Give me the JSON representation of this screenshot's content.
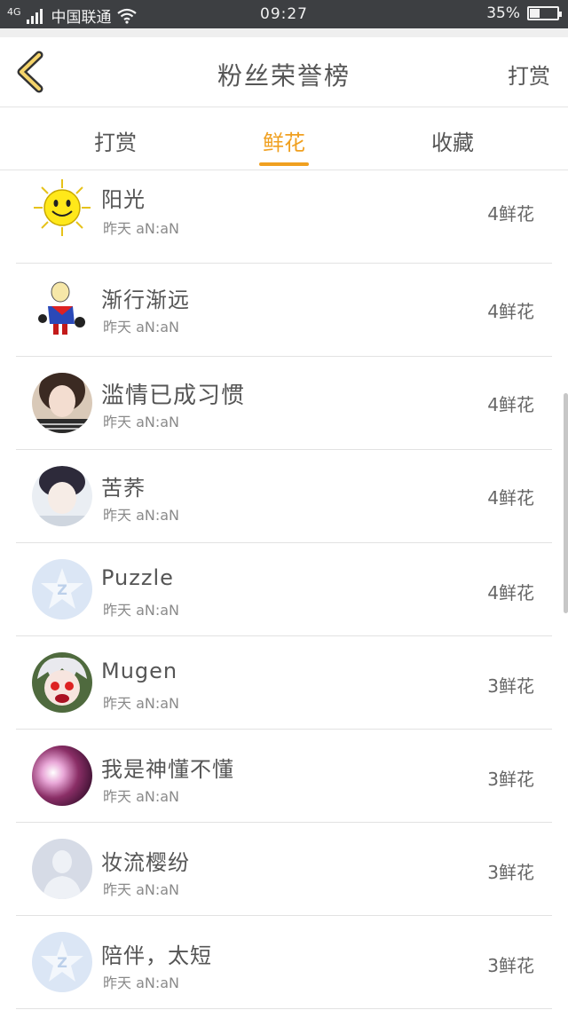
{
  "status_bar": {
    "network": "4G",
    "carrier": "中国联通",
    "time": "09:27",
    "battery": "35%",
    "battery_level": 0.35
  },
  "header": {
    "title": "粉丝荣誉榜",
    "action": "打赏",
    "back_icon": "chevron-left-icon",
    "accent": "#f0a020"
  },
  "tabs": [
    {
      "label": "打赏",
      "active": false
    },
    {
      "label": "鲜花",
      "active": true
    },
    {
      "label": "收藏",
      "active": false
    }
  ],
  "rows": [
    {
      "name": "阳光",
      "time": "昨天 aN:aN",
      "count": "4鲜花",
      "avatar": "sun-avatar"
    },
    {
      "name": "渐行渐远",
      "time": "昨天 aN:aN",
      "count": "4鲜花",
      "avatar": "cartoon-avatar"
    },
    {
      "name": "滥情已成习惯",
      "time": "昨天 aN:aN",
      "count": "4鲜花",
      "avatar": "photo-avatar"
    },
    {
      "name": "苦荞",
      "time": "昨天 aN:aN",
      "count": "4鲜花",
      "avatar": "photo-avatar"
    },
    {
      "name": "Puzzle",
      "time": "昨天 aN:aN",
      "count": "4鲜花",
      "avatar": "qq-default-avatar"
    },
    {
      "name": "Mugen",
      "time": "昨天 aN:aN",
      "count": "3鲜花",
      "avatar": "anime-avatar"
    },
    {
      "name": "我是神懂不懂",
      "time": "昨天 aN:aN",
      "count": "3鲜花",
      "avatar": "photo-avatar"
    },
    {
      "name": "妆流樱纷",
      "time": "昨天 aN:aN",
      "count": "3鲜花",
      "avatar": "default-user-avatar"
    },
    {
      "name": "陪伴，太短",
      "time": "昨天 aN:aN",
      "count": "3鲜花",
      "avatar": "qq-default-avatar"
    }
  ]
}
